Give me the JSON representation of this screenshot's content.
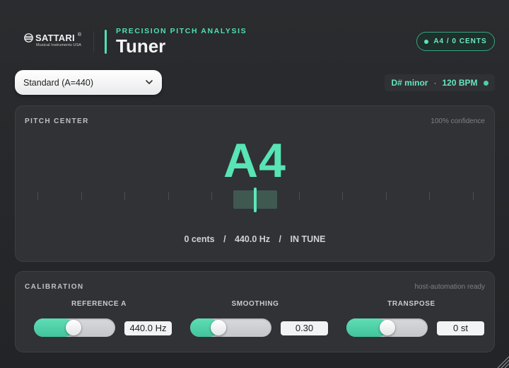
{
  "header": {
    "logo_name": "SATTARI",
    "logo_reg": "®",
    "logo_sub": "Musical Instruments USA",
    "eyebrow": "PRECISION PITCH ANALYSIS",
    "title": "Tuner",
    "status_pill": "A4 / 0 CENTS"
  },
  "preset": {
    "selected": "Standard (A=440)"
  },
  "key_badge": {
    "key": "D# minor",
    "separator": "·",
    "tempo": "120 BPM"
  },
  "pitch_panel": {
    "label": "PITCH CENTER",
    "confidence": "100% confidence",
    "note": "A4",
    "cents": "0 cents",
    "frequency": "440.0 Hz",
    "state": "IN TUNE",
    "slash": "/",
    "meter_offset_cents": 0
  },
  "calibration": {
    "label": "CALIBRATION",
    "note": "host-automation ready",
    "controls": [
      {
        "title": "REFERENCE A",
        "value": "440.0 Hz",
        "level": 0.48
      },
      {
        "title": "SMOOTHING",
        "value": "0.30",
        "level": 0.3
      },
      {
        "title": "TRANSPOSE",
        "value": "0 st",
        "level": 0.5
      }
    ]
  },
  "colors": {
    "accent": "#58e4b5",
    "background": "#26282b",
    "panel": "#303235"
  },
  "icons": {
    "logo": "sattari-logo-icon",
    "dropdown": "chevron-down-icon",
    "status": "status-dot-icon"
  }
}
